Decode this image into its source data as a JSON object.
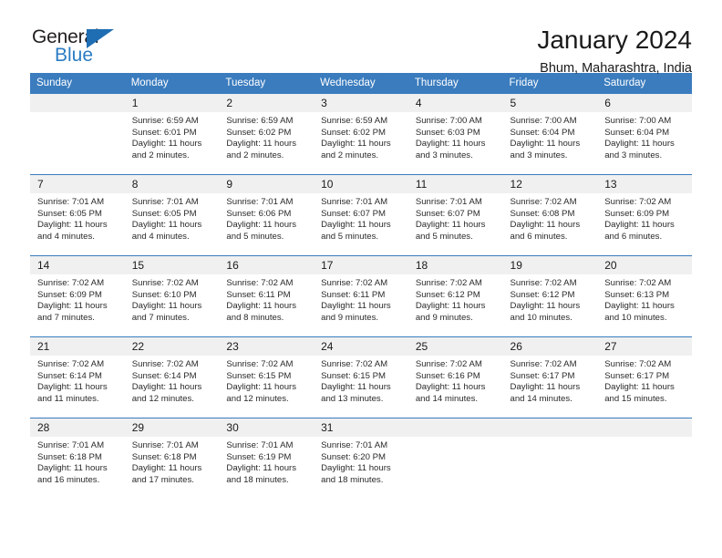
{
  "brand": {
    "name_part1": "General",
    "name_part2": "Blue",
    "accent_color": "#2b7cc4",
    "triangle_color": "#1f6eb4"
  },
  "header": {
    "title": "January 2024",
    "subtitle": "Bhum, Maharashtra, India",
    "header_bg_color": "#3a7cbe"
  },
  "weekday_headers": [
    "Sunday",
    "Monday",
    "Tuesday",
    "Wednesday",
    "Thursday",
    "Friday",
    "Saturday"
  ],
  "weeks": [
    [
      {
        "day": "",
        "sunrise": "",
        "sunset": "",
        "daylight_line1": "",
        "daylight_line2": "",
        "empty": true
      },
      {
        "day": "1",
        "sunrise": "Sunrise: 6:59 AM",
        "sunset": "Sunset: 6:01 PM",
        "daylight_line1": "Daylight: 11 hours",
        "daylight_line2": "and 2 minutes."
      },
      {
        "day": "2",
        "sunrise": "Sunrise: 6:59 AM",
        "sunset": "Sunset: 6:02 PM",
        "daylight_line1": "Daylight: 11 hours",
        "daylight_line2": "and 2 minutes."
      },
      {
        "day": "3",
        "sunrise": "Sunrise: 6:59 AM",
        "sunset": "Sunset: 6:02 PM",
        "daylight_line1": "Daylight: 11 hours",
        "daylight_line2": "and 2 minutes."
      },
      {
        "day": "4",
        "sunrise": "Sunrise: 7:00 AM",
        "sunset": "Sunset: 6:03 PM",
        "daylight_line1": "Daylight: 11 hours",
        "daylight_line2": "and 3 minutes."
      },
      {
        "day": "5",
        "sunrise": "Sunrise: 7:00 AM",
        "sunset": "Sunset: 6:04 PM",
        "daylight_line1": "Daylight: 11 hours",
        "daylight_line2": "and 3 minutes."
      },
      {
        "day": "6",
        "sunrise": "Sunrise: 7:00 AM",
        "sunset": "Sunset: 6:04 PM",
        "daylight_line1": "Daylight: 11 hours",
        "daylight_line2": "and 3 minutes."
      }
    ],
    [
      {
        "day": "7",
        "sunrise": "Sunrise: 7:01 AM",
        "sunset": "Sunset: 6:05 PM",
        "daylight_line1": "Daylight: 11 hours",
        "daylight_line2": "and 4 minutes."
      },
      {
        "day": "8",
        "sunrise": "Sunrise: 7:01 AM",
        "sunset": "Sunset: 6:05 PM",
        "daylight_line1": "Daylight: 11 hours",
        "daylight_line2": "and 4 minutes."
      },
      {
        "day": "9",
        "sunrise": "Sunrise: 7:01 AM",
        "sunset": "Sunset: 6:06 PM",
        "daylight_line1": "Daylight: 11 hours",
        "daylight_line2": "and 5 minutes."
      },
      {
        "day": "10",
        "sunrise": "Sunrise: 7:01 AM",
        "sunset": "Sunset: 6:07 PM",
        "daylight_line1": "Daylight: 11 hours",
        "daylight_line2": "and 5 minutes."
      },
      {
        "day": "11",
        "sunrise": "Sunrise: 7:01 AM",
        "sunset": "Sunset: 6:07 PM",
        "daylight_line1": "Daylight: 11 hours",
        "daylight_line2": "and 5 minutes."
      },
      {
        "day": "12",
        "sunrise": "Sunrise: 7:02 AM",
        "sunset": "Sunset: 6:08 PM",
        "daylight_line1": "Daylight: 11 hours",
        "daylight_line2": "and 6 minutes."
      },
      {
        "day": "13",
        "sunrise": "Sunrise: 7:02 AM",
        "sunset": "Sunset: 6:09 PM",
        "daylight_line1": "Daylight: 11 hours",
        "daylight_line2": "and 6 minutes."
      }
    ],
    [
      {
        "day": "14",
        "sunrise": "Sunrise: 7:02 AM",
        "sunset": "Sunset: 6:09 PM",
        "daylight_line1": "Daylight: 11 hours",
        "daylight_line2": "and 7 minutes."
      },
      {
        "day": "15",
        "sunrise": "Sunrise: 7:02 AM",
        "sunset": "Sunset: 6:10 PM",
        "daylight_line1": "Daylight: 11 hours",
        "daylight_line2": "and 7 minutes."
      },
      {
        "day": "16",
        "sunrise": "Sunrise: 7:02 AM",
        "sunset": "Sunset: 6:11 PM",
        "daylight_line1": "Daylight: 11 hours",
        "daylight_line2": "and 8 minutes."
      },
      {
        "day": "17",
        "sunrise": "Sunrise: 7:02 AM",
        "sunset": "Sunset: 6:11 PM",
        "daylight_line1": "Daylight: 11 hours",
        "daylight_line2": "and 9 minutes."
      },
      {
        "day": "18",
        "sunrise": "Sunrise: 7:02 AM",
        "sunset": "Sunset: 6:12 PM",
        "daylight_line1": "Daylight: 11 hours",
        "daylight_line2": "and 9 minutes."
      },
      {
        "day": "19",
        "sunrise": "Sunrise: 7:02 AM",
        "sunset": "Sunset: 6:12 PM",
        "daylight_line1": "Daylight: 11 hours",
        "daylight_line2": "and 10 minutes."
      },
      {
        "day": "20",
        "sunrise": "Sunrise: 7:02 AM",
        "sunset": "Sunset: 6:13 PM",
        "daylight_line1": "Daylight: 11 hours",
        "daylight_line2": "and 10 minutes."
      }
    ],
    [
      {
        "day": "21",
        "sunrise": "Sunrise: 7:02 AM",
        "sunset": "Sunset: 6:14 PM",
        "daylight_line1": "Daylight: 11 hours",
        "daylight_line2": "and 11 minutes."
      },
      {
        "day": "22",
        "sunrise": "Sunrise: 7:02 AM",
        "sunset": "Sunset: 6:14 PM",
        "daylight_line1": "Daylight: 11 hours",
        "daylight_line2": "and 12 minutes."
      },
      {
        "day": "23",
        "sunrise": "Sunrise: 7:02 AM",
        "sunset": "Sunset: 6:15 PM",
        "daylight_line1": "Daylight: 11 hours",
        "daylight_line2": "and 12 minutes."
      },
      {
        "day": "24",
        "sunrise": "Sunrise: 7:02 AM",
        "sunset": "Sunset: 6:15 PM",
        "daylight_line1": "Daylight: 11 hours",
        "daylight_line2": "and 13 minutes."
      },
      {
        "day": "25",
        "sunrise": "Sunrise: 7:02 AM",
        "sunset": "Sunset: 6:16 PM",
        "daylight_line1": "Daylight: 11 hours",
        "daylight_line2": "and 14 minutes."
      },
      {
        "day": "26",
        "sunrise": "Sunrise: 7:02 AM",
        "sunset": "Sunset: 6:17 PM",
        "daylight_line1": "Daylight: 11 hours",
        "daylight_line2": "and 14 minutes."
      },
      {
        "day": "27",
        "sunrise": "Sunrise: 7:02 AM",
        "sunset": "Sunset: 6:17 PM",
        "daylight_line1": "Daylight: 11 hours",
        "daylight_line2": "and 15 minutes."
      }
    ],
    [
      {
        "day": "28",
        "sunrise": "Sunrise: 7:01 AM",
        "sunset": "Sunset: 6:18 PM",
        "daylight_line1": "Daylight: 11 hours",
        "daylight_line2": "and 16 minutes."
      },
      {
        "day": "29",
        "sunrise": "Sunrise: 7:01 AM",
        "sunset": "Sunset: 6:18 PM",
        "daylight_line1": "Daylight: 11 hours",
        "daylight_line2": "and 17 minutes."
      },
      {
        "day": "30",
        "sunrise": "Sunrise: 7:01 AM",
        "sunset": "Sunset: 6:19 PM",
        "daylight_line1": "Daylight: 11 hours",
        "daylight_line2": "and 18 minutes."
      },
      {
        "day": "31",
        "sunrise": "Sunrise: 7:01 AM",
        "sunset": "Sunset: 6:20 PM",
        "daylight_line1": "Daylight: 11 hours",
        "daylight_line2": "and 18 minutes."
      },
      {
        "day": "",
        "sunrise": "",
        "sunset": "",
        "daylight_line1": "",
        "daylight_line2": "",
        "empty": true
      },
      {
        "day": "",
        "sunrise": "",
        "sunset": "",
        "daylight_line1": "",
        "daylight_line2": "",
        "empty": true
      },
      {
        "day": "",
        "sunrise": "",
        "sunset": "",
        "daylight_line1": "",
        "daylight_line2": "",
        "empty": true
      }
    ]
  ]
}
